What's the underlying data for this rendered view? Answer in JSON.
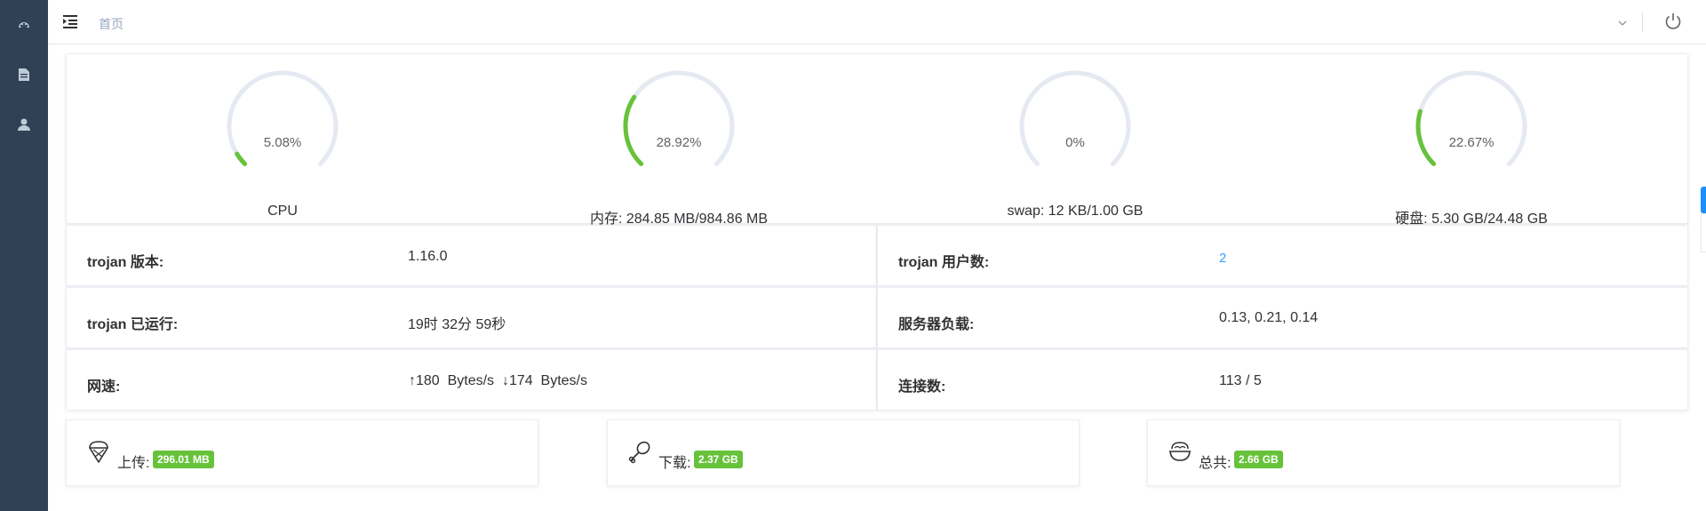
{
  "nav": {
    "breadcrumb": "首页",
    "sidebar_icons": [
      "dashboard-icon",
      "document-icon",
      "user-icon"
    ]
  },
  "gauges": [
    {
      "value": 5.08,
      "pct_label": "5.08%",
      "label": "CPU"
    },
    {
      "value": 28.92,
      "pct_label": "28.92%",
      "label": "内存: 284.85 MB/984.86 MB"
    },
    {
      "value": 0,
      "pct_label": "0%",
      "label": "swap: 12 KB/1.00 GB"
    },
    {
      "value": 22.67,
      "pct_label": "22.67%",
      "label": "硬盘: 5.30 GB/24.48 GB"
    }
  ],
  "info": {
    "version_key": "trojan 版本:",
    "version_val": "1.16.0",
    "users_key": "trojan 用户数:",
    "users_val": "2",
    "uptime_key": "trojan 已运行:",
    "uptime_val": "19时 32分 59秒",
    "load_key": "服务器负载:",
    "load_val": "0.13, 0.21, 0.14",
    "speed_key": "网速:",
    "speed_val": "↑180  Bytes/s  ↓174  Bytes/s",
    "conn_key": "连接数:",
    "conn_val": "113 / 5"
  },
  "traffic": {
    "upload_label": "上传:",
    "upload_val": "296.01 MB",
    "download_label": "下载:",
    "download_val": "2.37 GB",
    "total_label": "总共:",
    "total_val": "2.66 GB"
  },
  "colors": {
    "sidebar": "#304156",
    "gauge_track": "#e5e9f2",
    "gauge_fill": "#67c23a",
    "badge": "#67c23a",
    "link": "#409eff"
  }
}
